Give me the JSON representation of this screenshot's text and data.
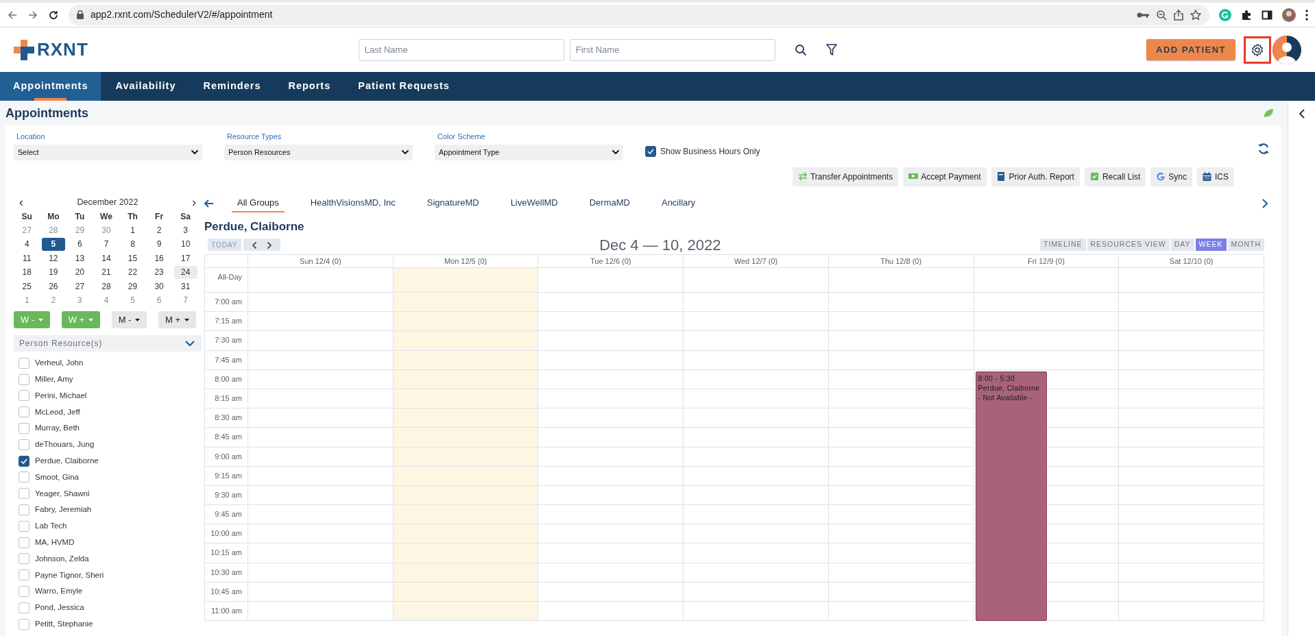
{
  "browser": {
    "url": "app2.rxnt.com/SchedulerV2/#/appointment"
  },
  "header": {
    "logo": "RXNT",
    "last_name_placeholder": "Last Name",
    "first_name_placeholder": "First Name",
    "add_patient": "ADD PATIENT",
    "settings_highlighted": true
  },
  "nav": [
    {
      "label": "Appointments",
      "selected": true
    },
    {
      "label": "Availability",
      "selected": false
    },
    {
      "label": "Reminders",
      "selected": false
    },
    {
      "label": "Reports",
      "selected": false
    },
    {
      "label": "Patient Requests",
      "selected": false
    }
  ],
  "page_title": "Appointments",
  "filters": [
    {
      "label": "Location",
      "value": "Select"
    },
    {
      "label": "Resource Types",
      "value": "Person Resources"
    },
    {
      "label": "Color Scheme",
      "value": "Appointment Type"
    }
  ],
  "business_hours": {
    "label": "Show Business Hours Only",
    "checked": true
  },
  "actions": [
    "Transfer Appointments",
    "Accept Payment",
    "Prior Auth. Report",
    "Recall List",
    "Sync",
    "ICS"
  ],
  "mini_calendar": {
    "prev": "‹",
    "title": "December 2022",
    "next": "›",
    "weekdays": [
      "Su",
      "Mo",
      "Tu",
      "We",
      "Th",
      "Fr",
      "Sa"
    ],
    "weeks": [
      [
        {
          "day": "27",
          "other_month": true,
          "selected": false,
          "shaded": false
        },
        {
          "day": "28",
          "other_month": true,
          "selected": false,
          "shaded": false
        },
        {
          "day": "29",
          "other_month": true,
          "selected": false,
          "shaded": false
        },
        {
          "day": "30",
          "other_month": true,
          "selected": false,
          "shaded": false
        },
        {
          "day": "1",
          "other_month": false,
          "selected": false,
          "shaded": false
        },
        {
          "day": "2",
          "other_month": false,
          "selected": false,
          "shaded": false
        },
        {
          "day": "3",
          "other_month": false,
          "selected": false,
          "shaded": false
        }
      ],
      [
        {
          "day": "4",
          "other_month": false,
          "selected": false,
          "shaded": false
        },
        {
          "day": "5",
          "other_month": false,
          "selected": true,
          "shaded": false
        },
        {
          "day": "6",
          "other_month": false,
          "selected": false,
          "shaded": false
        },
        {
          "day": "7",
          "other_month": false,
          "selected": false,
          "shaded": false
        },
        {
          "day": "8",
          "other_month": false,
          "selected": false,
          "shaded": false
        },
        {
          "day": "9",
          "other_month": false,
          "selected": false,
          "shaded": false
        },
        {
          "day": "10",
          "other_month": false,
          "selected": false,
          "shaded": false
        }
      ],
      [
        {
          "day": "11",
          "other_month": false,
          "selected": false,
          "shaded": false
        },
        {
          "day": "12",
          "other_month": false,
          "selected": false,
          "shaded": false
        },
        {
          "day": "13",
          "other_month": false,
          "selected": false,
          "shaded": false
        },
        {
          "day": "14",
          "other_month": false,
          "selected": false,
          "shaded": false
        },
        {
          "day": "15",
          "other_month": false,
          "selected": false,
          "shaded": false
        },
        {
          "day": "16",
          "other_month": false,
          "selected": false,
          "shaded": false
        },
        {
          "day": "17",
          "other_month": false,
          "selected": false,
          "shaded": false
        }
      ],
      [
        {
          "day": "18",
          "other_month": false,
          "selected": false,
          "shaded": false
        },
        {
          "day": "19",
          "other_month": false,
          "selected": false,
          "shaded": false
        },
        {
          "day": "20",
          "other_month": false,
          "selected": false,
          "shaded": false
        },
        {
          "day": "21",
          "other_month": false,
          "selected": false,
          "shaded": false
        },
        {
          "day": "22",
          "other_month": false,
          "selected": false,
          "shaded": false
        },
        {
          "day": "23",
          "other_month": false,
          "selected": false,
          "shaded": false
        },
        {
          "day": "24",
          "other_month": false,
          "selected": false,
          "shaded": true
        }
      ],
      [
        {
          "day": "25",
          "other_month": false,
          "selected": false,
          "shaded": false
        },
        {
          "day": "26",
          "other_month": false,
          "selected": false,
          "shaded": false
        },
        {
          "day": "27",
          "other_month": false,
          "selected": false,
          "shaded": false
        },
        {
          "day": "28",
          "other_month": false,
          "selected": false,
          "shaded": false
        },
        {
          "day": "29",
          "other_month": false,
          "selected": false,
          "shaded": false
        },
        {
          "day": "30",
          "other_month": false,
          "selected": false,
          "shaded": false
        },
        {
          "day": "31",
          "other_month": false,
          "selected": false,
          "shaded": false
        }
      ],
      [
        {
          "day": "1",
          "other_month": true,
          "selected": false,
          "shaded": false
        },
        {
          "day": "2",
          "other_month": true,
          "selected": false,
          "shaded": false
        },
        {
          "day": "3",
          "other_month": true,
          "selected": false,
          "shaded": false
        },
        {
          "day": "4",
          "other_month": true,
          "selected": false,
          "shaded": false
        },
        {
          "day": "5",
          "other_month": true,
          "selected": false,
          "shaded": false
        },
        {
          "day": "6",
          "other_month": true,
          "selected": false,
          "shaded": false
        },
        {
          "day": "7",
          "other_month": true,
          "selected": false,
          "shaded": false
        }
      ]
    ]
  },
  "jump_buttons": [
    {
      "label": "W -",
      "kind": "week"
    },
    {
      "label": "W +",
      "kind": "week"
    },
    {
      "label": "M -",
      "kind": "month"
    },
    {
      "label": "M +",
      "kind": "month"
    }
  ],
  "resources": {
    "title": "Person Resource(s)",
    "items": [
      {
        "name": "Verheul, John",
        "checked": false
      },
      {
        "name": "Miller, Amy",
        "checked": false
      },
      {
        "name": "Perini, Michael",
        "checked": false
      },
      {
        "name": "McLeod, Jeff",
        "checked": false
      },
      {
        "name": "Murray, Beth",
        "checked": false
      },
      {
        "name": "deThouars, Jung",
        "checked": false
      },
      {
        "name": "Perdue, Claiborne",
        "checked": true
      },
      {
        "name": "Smoot, Gina",
        "checked": false
      },
      {
        "name": "Yeager, Shawni",
        "checked": false
      },
      {
        "name": "Fabry, Jeremiah",
        "checked": false
      },
      {
        "name": "Lab Tech",
        "checked": false
      },
      {
        "name": "MA, HVMD",
        "checked": false
      },
      {
        "name": "Johnson, Zelda",
        "checked": false
      },
      {
        "name": "Payne Tignor, Sheri",
        "checked": false
      },
      {
        "name": "Warro, Emyle",
        "checked": false
      },
      {
        "name": "Pond, Jessica",
        "checked": false
      },
      {
        "name": "Petitt, Stephanie",
        "checked": false
      }
    ]
  },
  "groups": [
    {
      "label": "All Groups",
      "selected": true
    },
    {
      "label": "HealthVisionsMD, Inc",
      "selected": false
    },
    {
      "label": "SignatureMD",
      "selected": false
    },
    {
      "label": "LiveWellMD",
      "selected": false
    },
    {
      "label": "DermaMD",
      "selected": false
    },
    {
      "label": "Ancillary",
      "selected": false
    }
  ],
  "resource_name": "Perdue, Claiborne",
  "toolbar": {
    "today": "TODAY",
    "range": "Dec 4 — 10, 2022",
    "views": [
      {
        "label": "TIMELINE",
        "selected": false
      },
      {
        "label": "RESOURCES VIEW",
        "selected": false
      },
      {
        "label": "DAY",
        "selected": false
      },
      {
        "label": "WEEK",
        "selected": true
      },
      {
        "label": "MONTH",
        "selected": false
      }
    ]
  },
  "columns": [
    {
      "label": "Sun 12/4 (0)",
      "highlighted": false
    },
    {
      "label": "Mon 12/5 (0)",
      "highlighted": true
    },
    {
      "label": "Tue 12/6 (0)",
      "highlighted": false
    },
    {
      "label": "Wed 12/7 (0)",
      "highlighted": false
    },
    {
      "label": "Thu 12/8 (0)",
      "highlighted": false
    },
    {
      "label": "Fri 12/9 (0)",
      "highlighted": false,
      "events": [
        {
          "kind": "unavailable",
          "time": "8:00 - 5:30",
          "title": "Perdue, Claiborne",
          "note": "- Not Available -"
        }
      ]
    },
    {
      "label": "Sat 12/10 (0)",
      "highlighted": false
    }
  ],
  "time_slots": [
    "All-Day",
    "7:00 am",
    "7:15 am",
    "7:30 am",
    "7:45 am",
    "8:00 am",
    "8:15 am",
    "8:30 am",
    "8:45 am",
    "9:00 am",
    "9:15 am",
    "9:30 am",
    "9:45 am",
    "10:00 am",
    "10:15 am",
    "10:30 am",
    "10:45 am",
    "11:00 am"
  ]
}
